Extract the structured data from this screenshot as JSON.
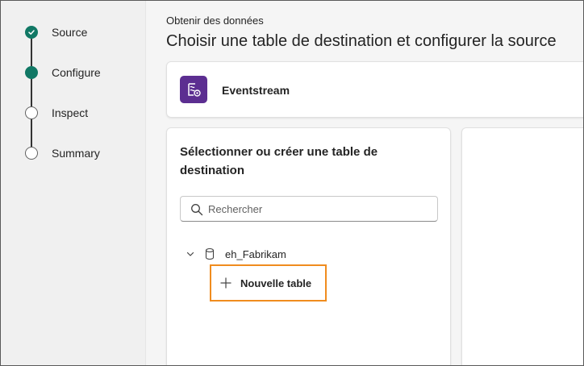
{
  "stepper": {
    "steps": [
      {
        "label": "Source",
        "state": "done"
      },
      {
        "label": "Configure",
        "state": "active"
      },
      {
        "label": "Inspect",
        "state": "pending"
      },
      {
        "label": "Summary",
        "state": "pending"
      }
    ]
  },
  "header": {
    "subtitle": "Obtenir des données",
    "title": "Choisir une table de destination et configurer la source"
  },
  "source": {
    "name": "Eventstream",
    "icon": "eventstream-icon",
    "icon_color": "#5c2e91"
  },
  "destination": {
    "heading": "Sélectionner ou créer une table de destination",
    "search": {
      "placeholder": "Rechercher",
      "value": ""
    },
    "database": {
      "name": "eh_Fabrikam",
      "expanded": true
    },
    "new_table_label": "Nouvelle table"
  },
  "colors": {
    "accent": "#117865",
    "highlight": "#f08c1e"
  }
}
